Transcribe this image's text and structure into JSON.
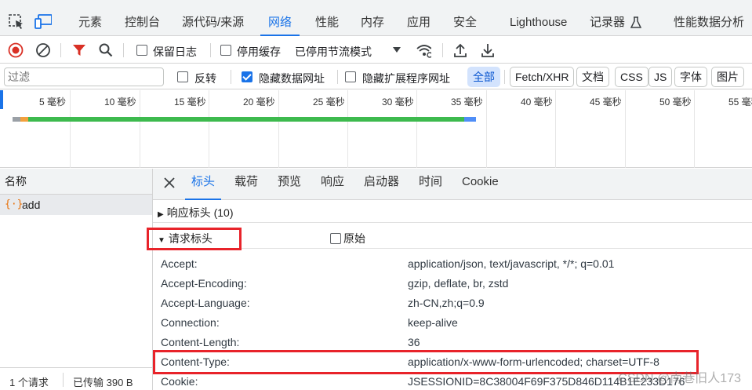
{
  "top_tabs": [
    "元素",
    "控制台",
    "源代码/来源",
    "网络",
    "性能",
    "内存",
    "应用",
    "安全",
    "Lighthouse",
    "记录器",
    "性能数据分析"
  ],
  "active_top_tab": "网络",
  "toolbar": {
    "preserve_log": "保留日志",
    "disable_cache": "停用缓存",
    "throttling": "已停用节流模式"
  },
  "filter": {
    "placeholder": "过滤",
    "invert": "反转",
    "hide_data_urls": "隐藏数据网址",
    "hide_extension_urls": "隐藏扩展程序网址",
    "types": [
      "全部",
      "Fetch/XHR",
      "文档",
      "CSS",
      "JS",
      "字体",
      "图片"
    ]
  },
  "timeline": {
    "ticks": [
      "5 毫秒",
      "10 毫秒",
      "15 毫秒",
      "20 毫秒",
      "25 毫秒",
      "30 毫秒",
      "35 毫秒",
      "40 毫秒",
      "45 毫秒",
      "50 毫秒",
      "55 毫秒"
    ]
  },
  "requests": {
    "column_name": "名称",
    "items": [
      {
        "icon": "{·}",
        "name": "add"
      }
    ]
  },
  "status": {
    "count": "1 个请求",
    "transferred": "已传输 390 B"
  },
  "detail_tabs": [
    "标头",
    "载荷",
    "预览",
    "响应",
    "启动器",
    "时间",
    "Cookie"
  ],
  "active_detail_tab": "标头",
  "response_headers_label": "响应标头 (10)",
  "request_headers_label": "请求标头",
  "raw_label": "原始",
  "request_headers": [
    {
      "name": "Accept:",
      "value": "application/json, text/javascript, */*; q=0.01"
    },
    {
      "name": "Accept-Encoding:",
      "value": "gzip, deflate, br, zstd"
    },
    {
      "name": "Accept-Language:",
      "value": "zh-CN,zh;q=0.9"
    },
    {
      "name": "Connection:",
      "value": "keep-alive"
    },
    {
      "name": "Content-Length:",
      "value": "36"
    },
    {
      "name": "Content-Type:",
      "value": "application/x-www-form-urlencoded; charset=UTF-8"
    },
    {
      "name": "Cookie:",
      "value": "JSESSIONID=8C38004F69F375D846D114B1E233D176"
    }
  ],
  "watermark": "CSDN @南巷旧人173",
  "colors": {
    "accent": "#1a73e8",
    "highlight_box": "#e8232a",
    "record_red": "#d93025",
    "timeline_green": "#3dba4e"
  }
}
